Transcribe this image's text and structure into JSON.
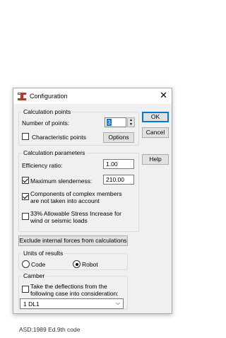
{
  "dialog": {
    "title": "Configuration",
    "close_glyph": "✕",
    "calc_points": {
      "caption": "Calculation points",
      "num_points_label": "Number of points:",
      "num_points_value": "3",
      "characteristic_label": "Characteristic points",
      "characteristic_checked": false,
      "options_label": "Options"
    },
    "buttons": {
      "ok": "OK",
      "cancel": "Cancel",
      "help": "Help"
    },
    "calc_params": {
      "caption": "Calculation parameters",
      "efficiency_label": "Efficiency ratio:",
      "efficiency_value": "1.00",
      "max_slenderness_label": "Maximum slenderness:",
      "max_slenderness_checked": true,
      "max_slenderness_value": "210.00",
      "complex_line1": "Components of complex members",
      "complex_line2": "are not taken into account",
      "complex_checked": true,
      "stress_line1": "33% Allowable Stress Increase for",
      "stress_line2": "wind or seismic loads",
      "stress_checked": false
    },
    "exclude_button": "Exclude internal forces from calculations",
    "units": {
      "caption": "Units of results",
      "code_label": "Code",
      "robot_label": "Robot",
      "selected": "Robot"
    },
    "camber": {
      "caption": "Camber",
      "take_line1": "Take the deflections from the",
      "take_line2": "following case into consideration:",
      "take_checked": false,
      "case_value": "1  DL1"
    }
  },
  "footer_text": "ASD:1989 Ed.9th code",
  "icons": {
    "app": "robot-app-icon",
    "close": "close-icon",
    "spin": "spinner-arrows-icon",
    "dropdown": "chevron-down-icon"
  },
  "colors": {
    "accent": "#0078d7",
    "app_icon": "#d42a1f"
  }
}
